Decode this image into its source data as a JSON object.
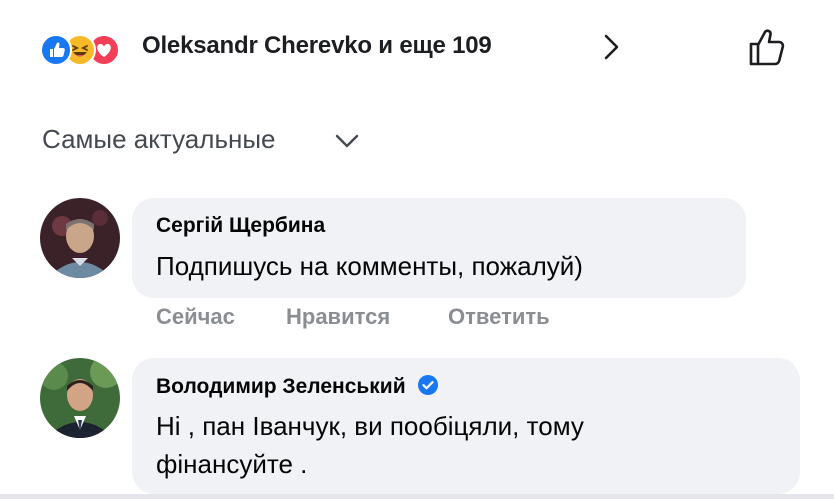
{
  "reactions": {
    "icons": [
      "like-icon",
      "haha-icon",
      "love-icon"
    ],
    "summary": "Oleksandr Cherevko и еще 109"
  },
  "sort": {
    "label": "Самые актуальные"
  },
  "comments": [
    {
      "author": "Сергій Щербина",
      "text": "Подпишусь на комменты, пожалуй)",
      "actions": {
        "time": "Сейчас",
        "like": "Нравится",
        "reply": "Ответить"
      }
    },
    {
      "author": "Володимир Зеленський",
      "verified": true,
      "text_lines": [
        "Ні , пан Іванчук, ви пообіцяли, тому",
        "фінансуйте ."
      ]
    }
  ],
  "colors": {
    "like_blue": "#1877f2",
    "haha_yellow": "#f7b928",
    "love_red": "#f33e58",
    "bubble_bg": "#f0f2f5",
    "muted_text": "#8a8d91"
  }
}
